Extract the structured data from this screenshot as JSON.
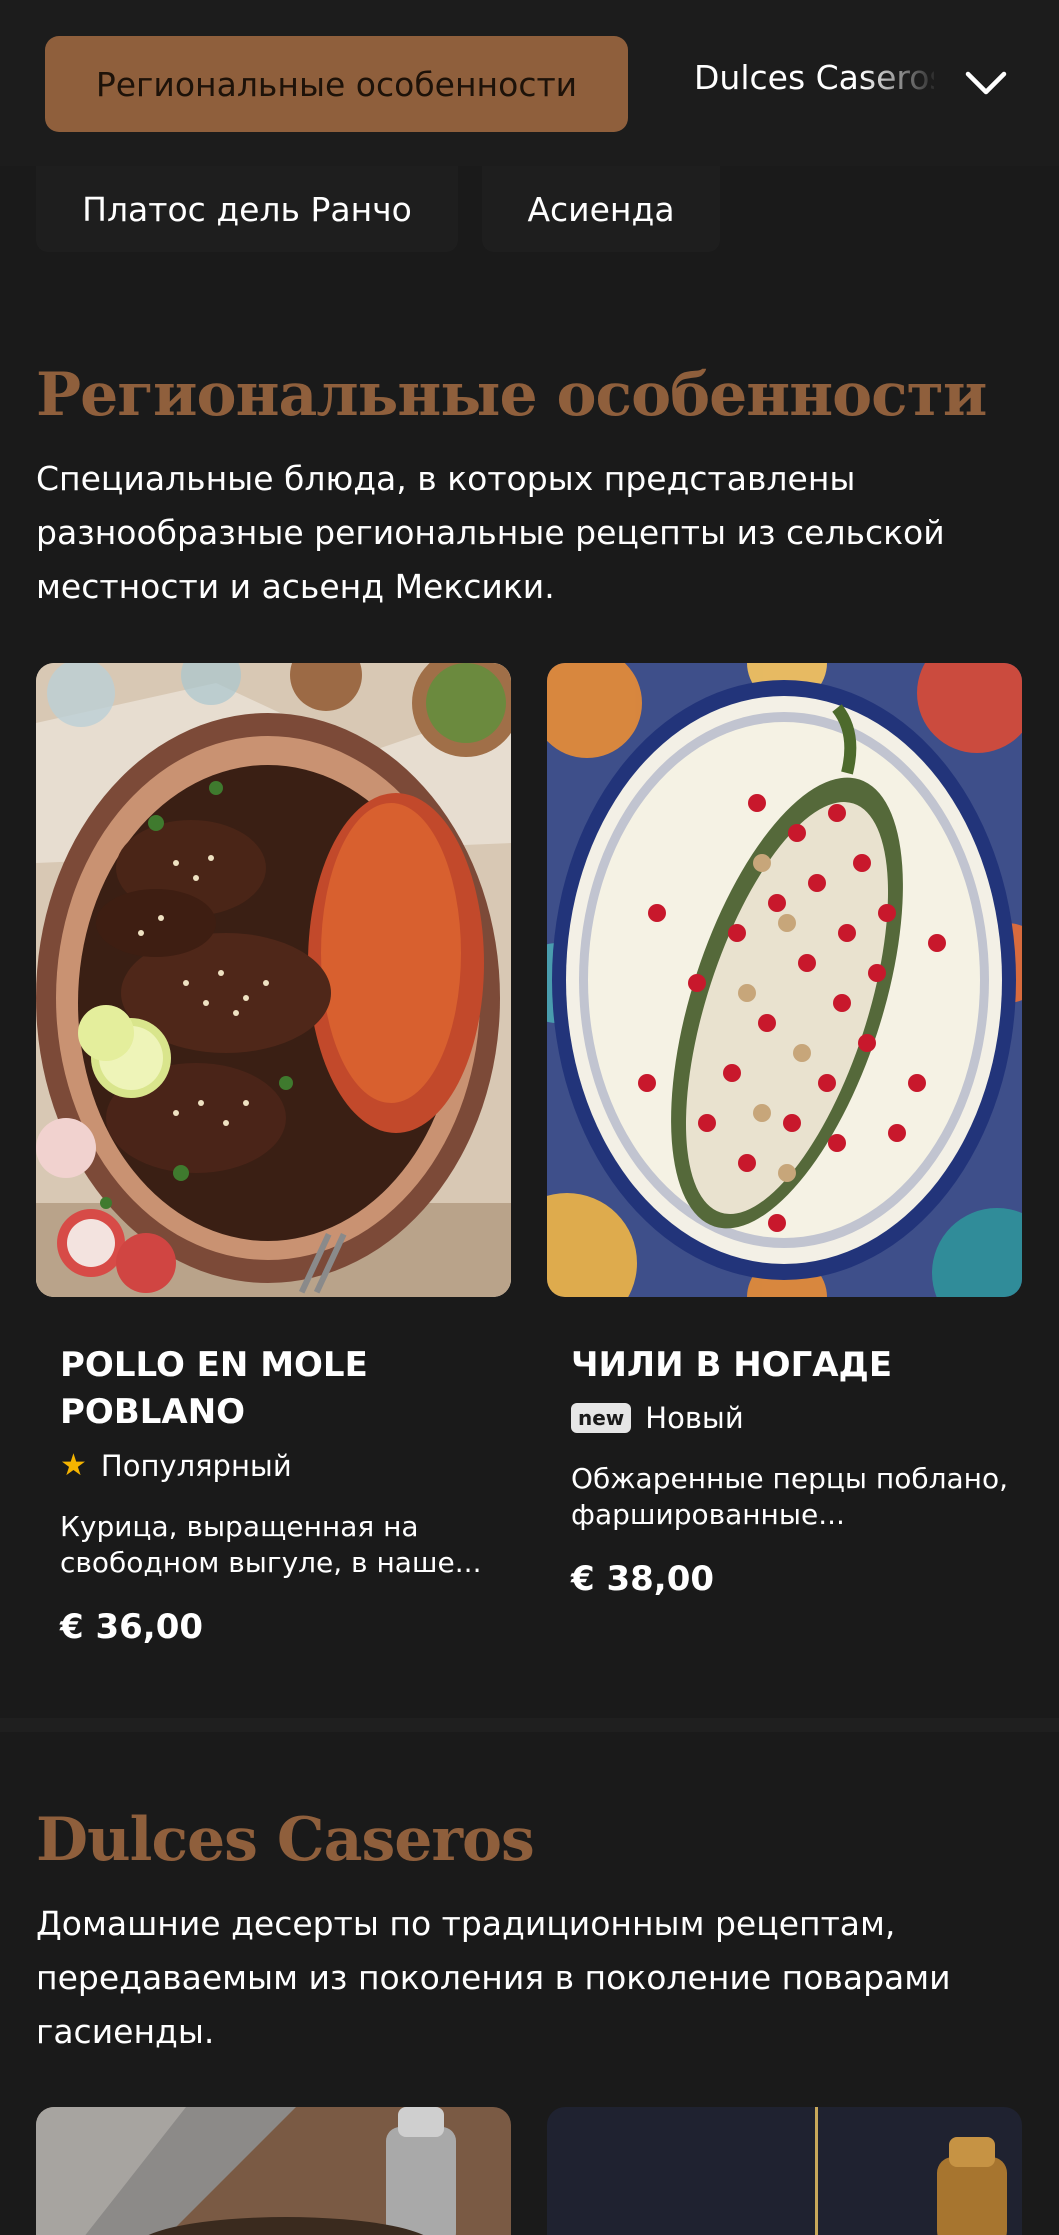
{
  "nav": {
    "active_tab": "Региональные особенности",
    "next_tab": "Dulces Caseros",
    "chevron_icon": "chevron-down-icon"
  },
  "subtabs": [
    "Платос дель Ранчо",
    "Асиенда"
  ],
  "section1": {
    "title": "Региональные особенности",
    "description": "Специальные блюда, в которых представлены разнообразные региональные рецепты из сельской местности и асьенд Мексики.",
    "items": [
      {
        "name": "Pollo en Mole Poblano",
        "badge_icon": "star-icon",
        "badge_label": "Популярный",
        "description": "Курица, выращенная на свободном выгуле, в наше...",
        "price": "€ 36,00"
      },
      {
        "name": "Чили в Ногаде",
        "badge_tag": "new",
        "badge_label": "Новый",
        "description": "Обжаренные перцы поблано, фаршированные...",
        "price": "€ 38,00"
      }
    ]
  },
  "section2": {
    "title": "Dulces Caseros",
    "description": "Домашние десерты по традиционным рецептам, передаваемым из поколения в поколение поварами гасиенды."
  },
  "colors": {
    "background": "#1a1a1a",
    "accent": "#8f5f3c",
    "star": "#f5b400"
  }
}
